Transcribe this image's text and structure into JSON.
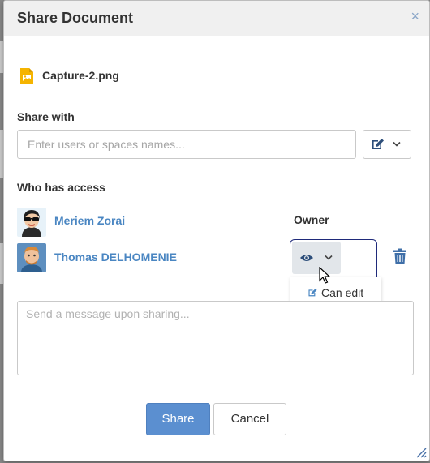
{
  "dialog": {
    "title": "Share Document",
    "close_glyph": "×"
  },
  "file": {
    "name": "Capture-2.png",
    "icon": "image-file-icon"
  },
  "share_with": {
    "label": "Share with",
    "input_placeholder": "Enter users or spaces names...",
    "input_value": "",
    "permission_icon": "edit-icon"
  },
  "access": {
    "label": "Who has access",
    "users": [
      {
        "name": "Meriem Zorai",
        "role": "Owner"
      },
      {
        "name": "Thomas DELHOMENIE",
        "permission_icon": "eye-icon"
      }
    ],
    "dropdown": {
      "items": [
        {
          "label": "Can edit",
          "icon": "edit-icon"
        }
      ]
    }
  },
  "message": {
    "placeholder": "Send a message upon sharing...",
    "value": ""
  },
  "buttons": {
    "share": "Share",
    "cancel": "Cancel"
  },
  "colors": {
    "primary": "#5b8fd0",
    "link": "#4a86c2",
    "highlight_border": "#1f2a7a"
  }
}
